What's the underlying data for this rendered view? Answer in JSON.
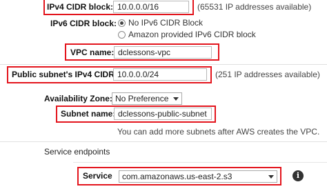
{
  "ipv4_cidr": {
    "label": "IPv4 CIDR block:*",
    "value": "10.0.0.0/16",
    "note": "(65531 IP addresses available)"
  },
  "ipv6_cidr": {
    "label": "IPv6 CIDR block:",
    "options": [
      "No IPv6 CIDR Block",
      "Amazon provided IPv6 CIDR block"
    ],
    "selected": "No IPv6 CIDR Block"
  },
  "vpc_name": {
    "label": "VPC name:",
    "value": "dclessons-vpc"
  },
  "subnet_cidr": {
    "label": "Public subnet's IPv4 CIDR:*",
    "value": "10.0.0.0/24",
    "note": "(251 IP addresses available)"
  },
  "availability_zone": {
    "label": "Availability Zone:*",
    "selected": "No Preference"
  },
  "subnet_name": {
    "label": "Subnet name:",
    "value": "dclessons-public-subnet"
  },
  "subnet_hint": "You can add more subnets after AWS creates the VPC.",
  "service_endpoints": {
    "heading": "Service endpoints",
    "service_label": "Service",
    "service_selected": "com.amazonaws.us-east-2.s3",
    "info_icon": "info-icon"
  },
  "colors": {
    "highlight": "#e3141c",
    "info_icon_bg": "#333333"
  }
}
